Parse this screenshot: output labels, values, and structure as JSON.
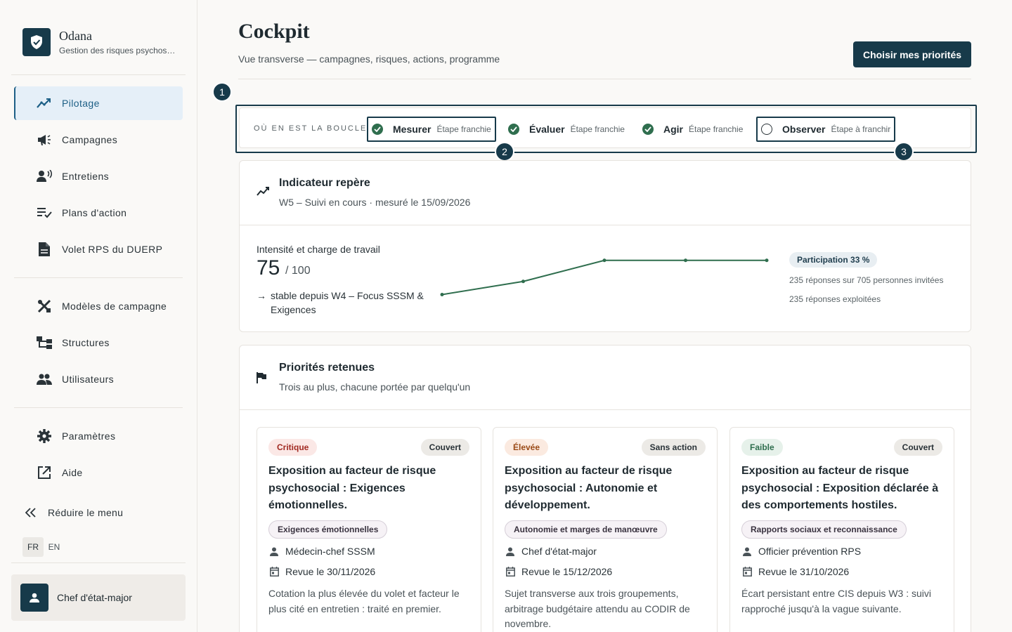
{
  "app": {
    "name": "Odana",
    "subtitle": "Gestion des risques psychos…"
  },
  "sidebar": {
    "primary": [
      {
        "label": "Pilotage",
        "icon": "trend-chart-icon",
        "active": true
      },
      {
        "label": "Campagnes",
        "icon": "megaphone-icon"
      },
      {
        "label": "Entretiens",
        "icon": "person-voice-icon"
      },
      {
        "label": "Plans d'action",
        "icon": "checklist-icon"
      },
      {
        "label": "Volet RPS du DUERP",
        "icon": "document-icon"
      }
    ],
    "secondary": [
      {
        "label": "Modèles de campagne",
        "icon": "tools-icon"
      },
      {
        "label": "Structures",
        "icon": "hierarchy-icon"
      },
      {
        "label": "Utilisateurs",
        "icon": "users-icon"
      }
    ],
    "tertiary": [
      {
        "label": "Paramètres",
        "icon": "gear-icon"
      },
      {
        "label": "Aide",
        "icon": "external-link-icon"
      }
    ],
    "collapse_label": "Réduire le menu",
    "languages": [
      "FR",
      "EN"
    ],
    "user_name": "Chef d'état-major"
  },
  "header": {
    "title": "Cockpit",
    "subtitle": "Vue transverse — campagnes, risques, actions, programme",
    "cta_label": "Choisir mes priorités"
  },
  "tour_badges": [
    "1",
    "2",
    "3"
  ],
  "loop": {
    "label": "OÙ EN EST LA BOUCLE",
    "steps": [
      {
        "name": "Mesurer",
        "status": "Étape franchie",
        "done": true
      },
      {
        "name": "Évaluer",
        "status": "Étape franchie",
        "done": true
      },
      {
        "name": "Agir",
        "status": "Étape franchie",
        "done": true
      },
      {
        "name": "Observer",
        "status": "Étape à franchir",
        "done": false
      }
    ]
  },
  "indicator": {
    "title": "Indicateur repère",
    "subtitle": "W5 – Suivi en cours · mesuré le 15/09/2026",
    "label": "Intensité et charge de travail",
    "value": "75",
    "max": "/ 100",
    "trend_arrow": "→",
    "trend": "stable depuis W4 – Focus SSSM & Exigences",
    "participation": "Participation 33 %",
    "responses": "235 réponses sur 705 personnes invitées",
    "exploited": "235 réponses exploitées",
    "sparkline": [
      62,
      67,
      75,
      75,
      75
    ],
    "accent": "#2f6e4e"
  },
  "priorities": {
    "title": "Priorités retenues",
    "subtitle": "Trois au plus, chacune portée par quelqu'un",
    "items": [
      {
        "severity": "Critique",
        "coverage": "Couvert",
        "title": "Exposition au facteur de risque psychosocial : Exigences émotionnelles.",
        "tag": "Exigences émotionnelles",
        "owner": "Médecin-chef SSSM",
        "review": "Revue le 30/11/2026",
        "description": "Cotation la plus élevée du volet et facteur le plus cité en entretien : traité en premier."
      },
      {
        "severity": "Élevée",
        "coverage": "Sans action",
        "title": "Exposition au facteur de risque psychosocial : Autonomie et développement.",
        "tag": "Autonomie et marges de manœuvre",
        "owner": "Chef d'état-major",
        "review": "Revue le 15/12/2026",
        "description": "Sujet transverse aux trois groupements, arbitrage budgétaire attendu au CODIR de novembre."
      },
      {
        "severity": "Faible",
        "coverage": "Couvert",
        "title": "Exposition au facteur de risque psychosocial : Exposition déclarée à des comportements hostiles.",
        "tag": "Rapports sociaux et reconnaissance",
        "owner": "Officier prévention RPS",
        "review": "Revue le 31/10/2026",
        "description": "Écart persistant entre CIS depuis W3 : suivi rapproché jusqu'à la vague suivante."
      }
    ]
  }
}
